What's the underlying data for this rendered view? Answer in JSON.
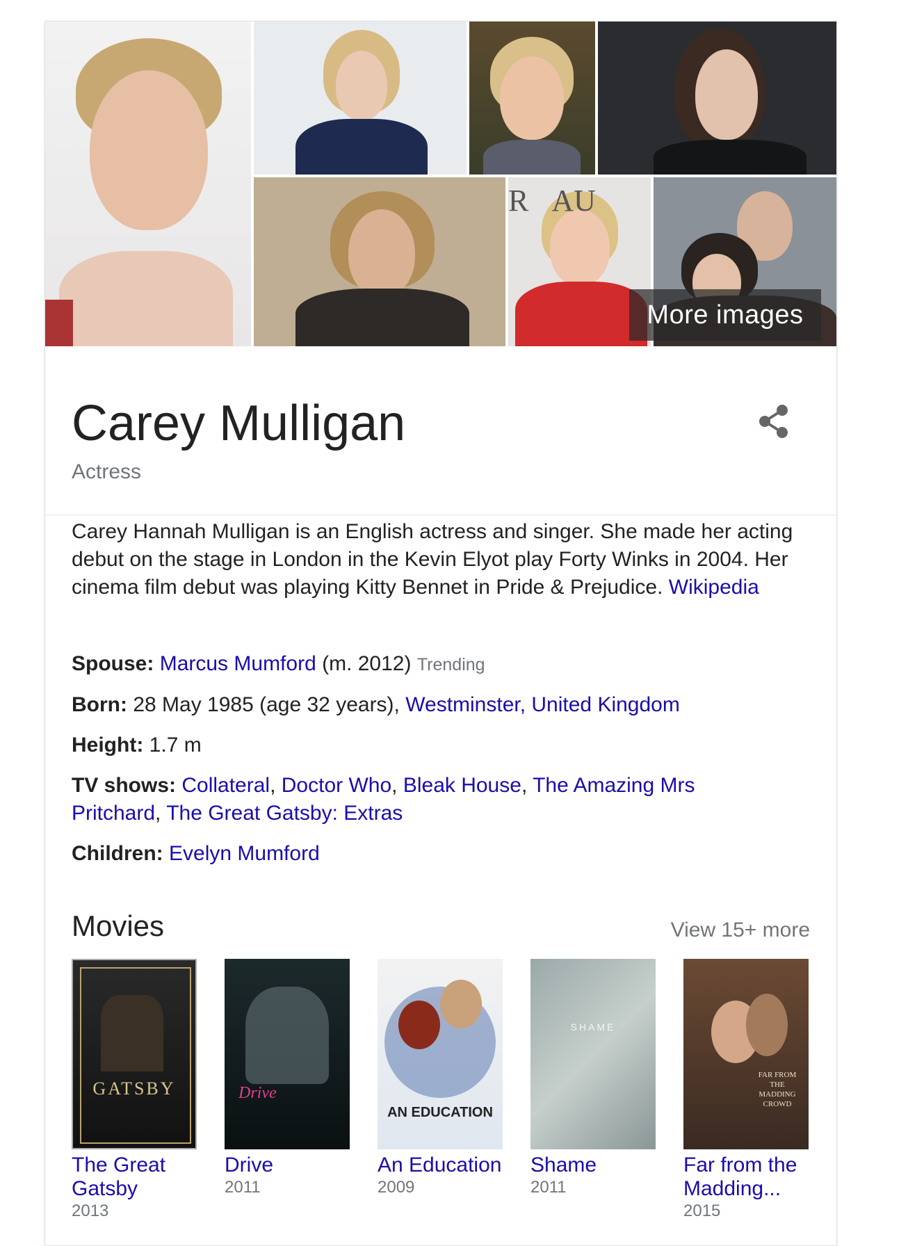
{
  "collage": {
    "more_images_label": "More images"
  },
  "header": {
    "name": "Carey Mulligan",
    "subtitle": "Actress"
  },
  "description": {
    "text": "Carey Hannah Mulligan is an English actress and singer. She made her acting debut on the stage in London in the Kevin Elyot play Forty Winks in 2004. Her cinema film debut was playing Kitty Bennet in Pride & Prejudice.",
    "source_link": "Wikipedia"
  },
  "facts": {
    "spouse": {
      "label": "Spouse:",
      "name": "Marcus Mumford",
      "detail": "(m. 2012)",
      "badge": "Trending"
    },
    "born": {
      "label": "Born:",
      "text": "28 May 1985 (age 32 years),",
      "place": "Westminster, United Kingdom"
    },
    "height": {
      "label": "Height:",
      "value": "1.7 m"
    },
    "tv_shows": {
      "label": "TV shows:",
      "items": [
        "Collateral",
        "Doctor Who",
        "Bleak House",
        "The Amazing Mrs Pritchard",
        "The Great Gatsby: Extras"
      ]
    },
    "children": {
      "label": "Children:",
      "name": "Evelyn Mumford"
    }
  },
  "movies": {
    "title": "Movies",
    "more_label": "View 15+ more",
    "items": [
      {
        "title": "The Great Gatsby",
        "year": "2013",
        "poster_text": "GATSBY"
      },
      {
        "title": "Drive",
        "year": "2011",
        "poster_text": "Drive"
      },
      {
        "title": "An Education",
        "year": "2009",
        "poster_text": "AN EDUCATION"
      },
      {
        "title": "Shame",
        "year": "2011",
        "poster_text": "SHAME"
      },
      {
        "title": "Far from the Madding...",
        "year": "2015",
        "poster_text": "FAR FROM THE MADDING CROWD"
      }
    ]
  },
  "icons": {
    "share": "share-icon"
  }
}
